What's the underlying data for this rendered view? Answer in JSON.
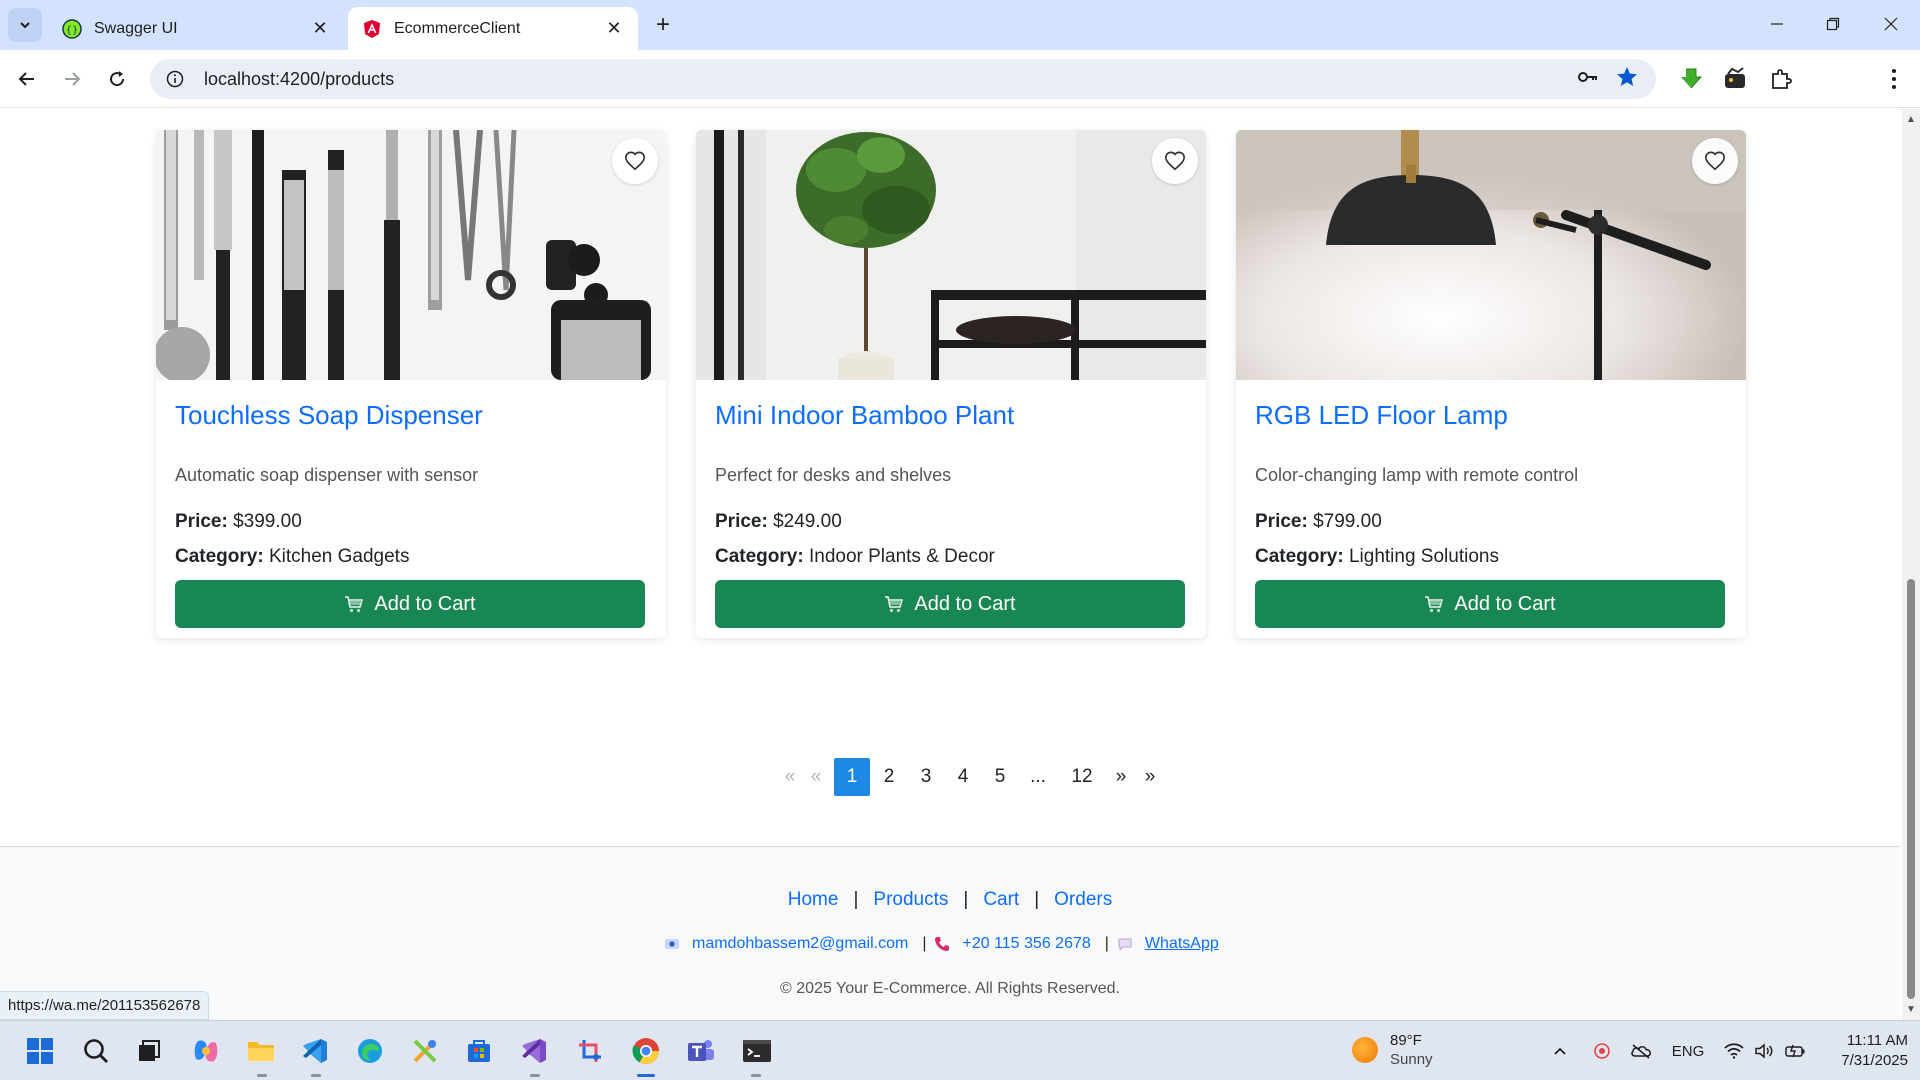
{
  "browser": {
    "tabs": [
      {
        "title": "Swagger UI",
        "active": false,
        "icon": "swagger-icon"
      },
      {
        "title": "EcommerceClient",
        "active": true,
        "icon": "angular-icon"
      }
    ],
    "url": "localhost:4200/products",
    "status_url": "https://wa.me/201153562678"
  },
  "products": [
    {
      "title": "Touchless Soap Dispenser",
      "description": "Automatic soap dispenser with sensor",
      "price_label": "Price:",
      "price": "$399.00",
      "category_label": "Category:",
      "category": "Kitchen Gadgets",
      "button": "Add to Cart"
    },
    {
      "title": "Mini Indoor Bamboo Plant",
      "description": "Perfect for desks and shelves",
      "price_label": "Price:",
      "price": "$249.00",
      "category_label": "Category:",
      "category": "Indoor Plants & Decor",
      "button": "Add to Cart"
    },
    {
      "title": "RGB LED Floor Lamp",
      "description": "Color-changing lamp with remote control",
      "price_label": "Price:",
      "price": "$799.00",
      "category_label": "Category:",
      "category": "Lighting Solutions",
      "button": "Add to Cart"
    }
  ],
  "pagination": {
    "first": "«",
    "prev": "«",
    "pages": [
      "1",
      "2",
      "3",
      "4",
      "5"
    ],
    "ellipsis": "...",
    "last_page": "12",
    "next": "»",
    "last": "»",
    "current": "1"
  },
  "footer": {
    "links": [
      "Home",
      "Products",
      "Cart",
      "Orders"
    ],
    "separator": "|",
    "email": "mamdohbassem2@gmail.com",
    "phone": "+20 115 356 2678",
    "whatsapp": "WhatsApp",
    "copyright": "© 2025 Your E-Commerce. All Rights Reserved."
  },
  "taskbar": {
    "weather_temp": "89°F",
    "weather_desc": "Sunny",
    "language": "ENG",
    "time": "11:11 AM",
    "date": "7/31/2025"
  },
  "colors": {
    "link": "#0d6efd",
    "cart_button": "#198754",
    "active_page": "#1e88e5",
    "tabbar": "#d3e3fd"
  }
}
